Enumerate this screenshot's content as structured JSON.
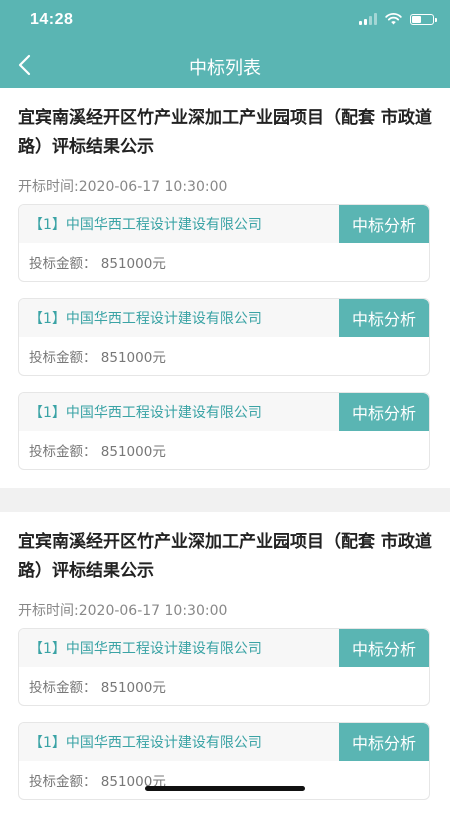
{
  "status": {
    "time": "14:28"
  },
  "header": {
    "title": "中标列表"
  },
  "groups": [
    {
      "title": "宜宾南溪经开区竹产业深加工产业园项目（配套 市政道路）评标结果公示",
      "open_time": "开标时间:2020-06-17 10:30:00",
      "cards": [
        {
          "index": "【1】",
          "company": "中国华西工程设计建设有限公司",
          "button": "中标分析",
          "amount": "投标金额：  851000元"
        },
        {
          "index": "【1】",
          "company": "中国华西工程设计建设有限公司",
          "button": "中标分析",
          "amount": "投标金额：  851000元"
        },
        {
          "index": "【1】",
          "company": "中国华西工程设计建设有限公司",
          "button": "中标分析",
          "amount": "投标金额：  851000元"
        }
      ]
    },
    {
      "title": "宜宾南溪经开区竹产业深加工产业园项目（配套 市政道路）评标结果公示",
      "open_time": "开标时间:2020-06-17 10:30:00",
      "cards": [
        {
          "index": "【1】",
          "company": "中国华西工程设计建设有限公司",
          "button": "中标分析",
          "amount": "投标金额：  851000元"
        },
        {
          "index": "【1】",
          "company": "中国华西工程设计建设有限公司",
          "button": "中标分析",
          "amount": "投标金额：  851000元"
        }
      ]
    }
  ]
}
